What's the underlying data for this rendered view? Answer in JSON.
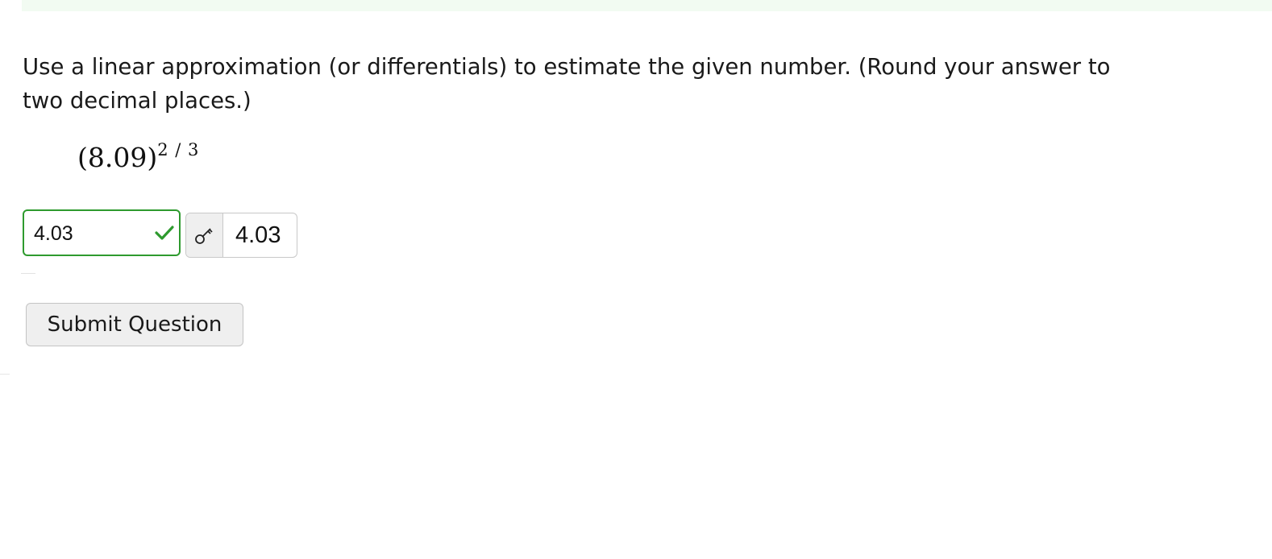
{
  "question": {
    "text": "Use a linear approximation (or differentials) to estimate the given number. (Round your answer to two decimal places.)",
    "expression": {
      "base": "(8.09)",
      "exponent": "2 / 3"
    }
  },
  "answer": {
    "value": "4.03",
    "status": "correct",
    "status_icon": "check-icon",
    "status_color": "#2e9a2e"
  },
  "correct_answer": {
    "icon": "key-icon",
    "value": "4.03"
  },
  "actions": {
    "submit_label": "Submit Question"
  }
}
